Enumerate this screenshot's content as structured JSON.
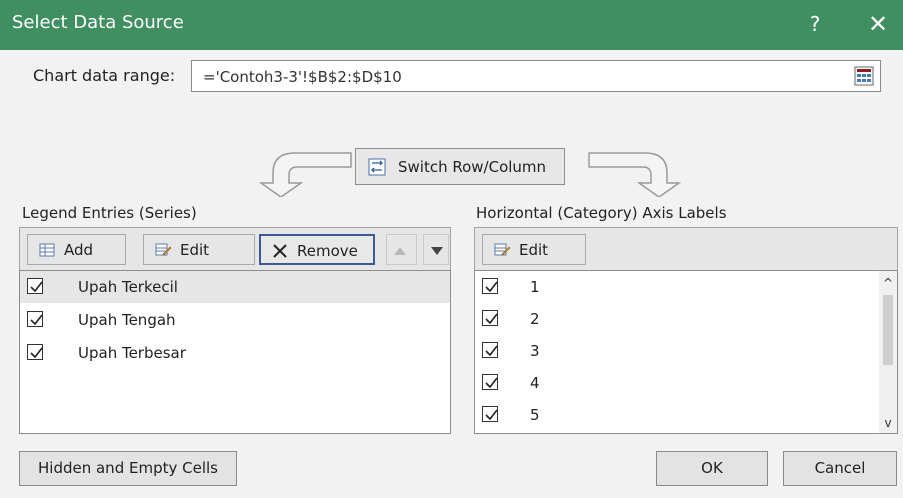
{
  "window": {
    "title": "Select Data Source",
    "help": "?",
    "close": "✕"
  },
  "range": {
    "label": "Chart data range:",
    "value": "='Contoh3-3'!$B$2:$D$10"
  },
  "switch_button": {
    "label": "Switch Row/Column"
  },
  "legend": {
    "title": "Legend Entries (Series)",
    "buttons": {
      "add": "Add",
      "edit": "Edit",
      "remove": "Remove"
    },
    "items": [
      {
        "label": "Upah Terkecil",
        "checked": true,
        "selected": true
      },
      {
        "label": "Upah Tengah",
        "checked": true,
        "selected": false
      },
      {
        "label": "Upah Terbesar",
        "checked": true,
        "selected": false
      }
    ]
  },
  "axis": {
    "title": "Horizontal (Category) Axis Labels",
    "edit": "Edit",
    "items": [
      "1",
      "2",
      "3",
      "4",
      "5"
    ]
  },
  "footer": {
    "hidden_cells": "Hidden and Empty Cells",
    "ok": "OK",
    "cancel": "Cancel"
  },
  "icons": {
    "range_picker": "range-picker-icon",
    "switch": "switch-rowcol-icon",
    "add": "add-icon",
    "edit": "edit-icon",
    "remove": "remove-x-icon",
    "up": "up-triangle-icon",
    "down": "down-triangle-icon"
  },
  "colors": {
    "title_bar": "#3f8f61",
    "remove_border": "#3b5a9a"
  }
}
